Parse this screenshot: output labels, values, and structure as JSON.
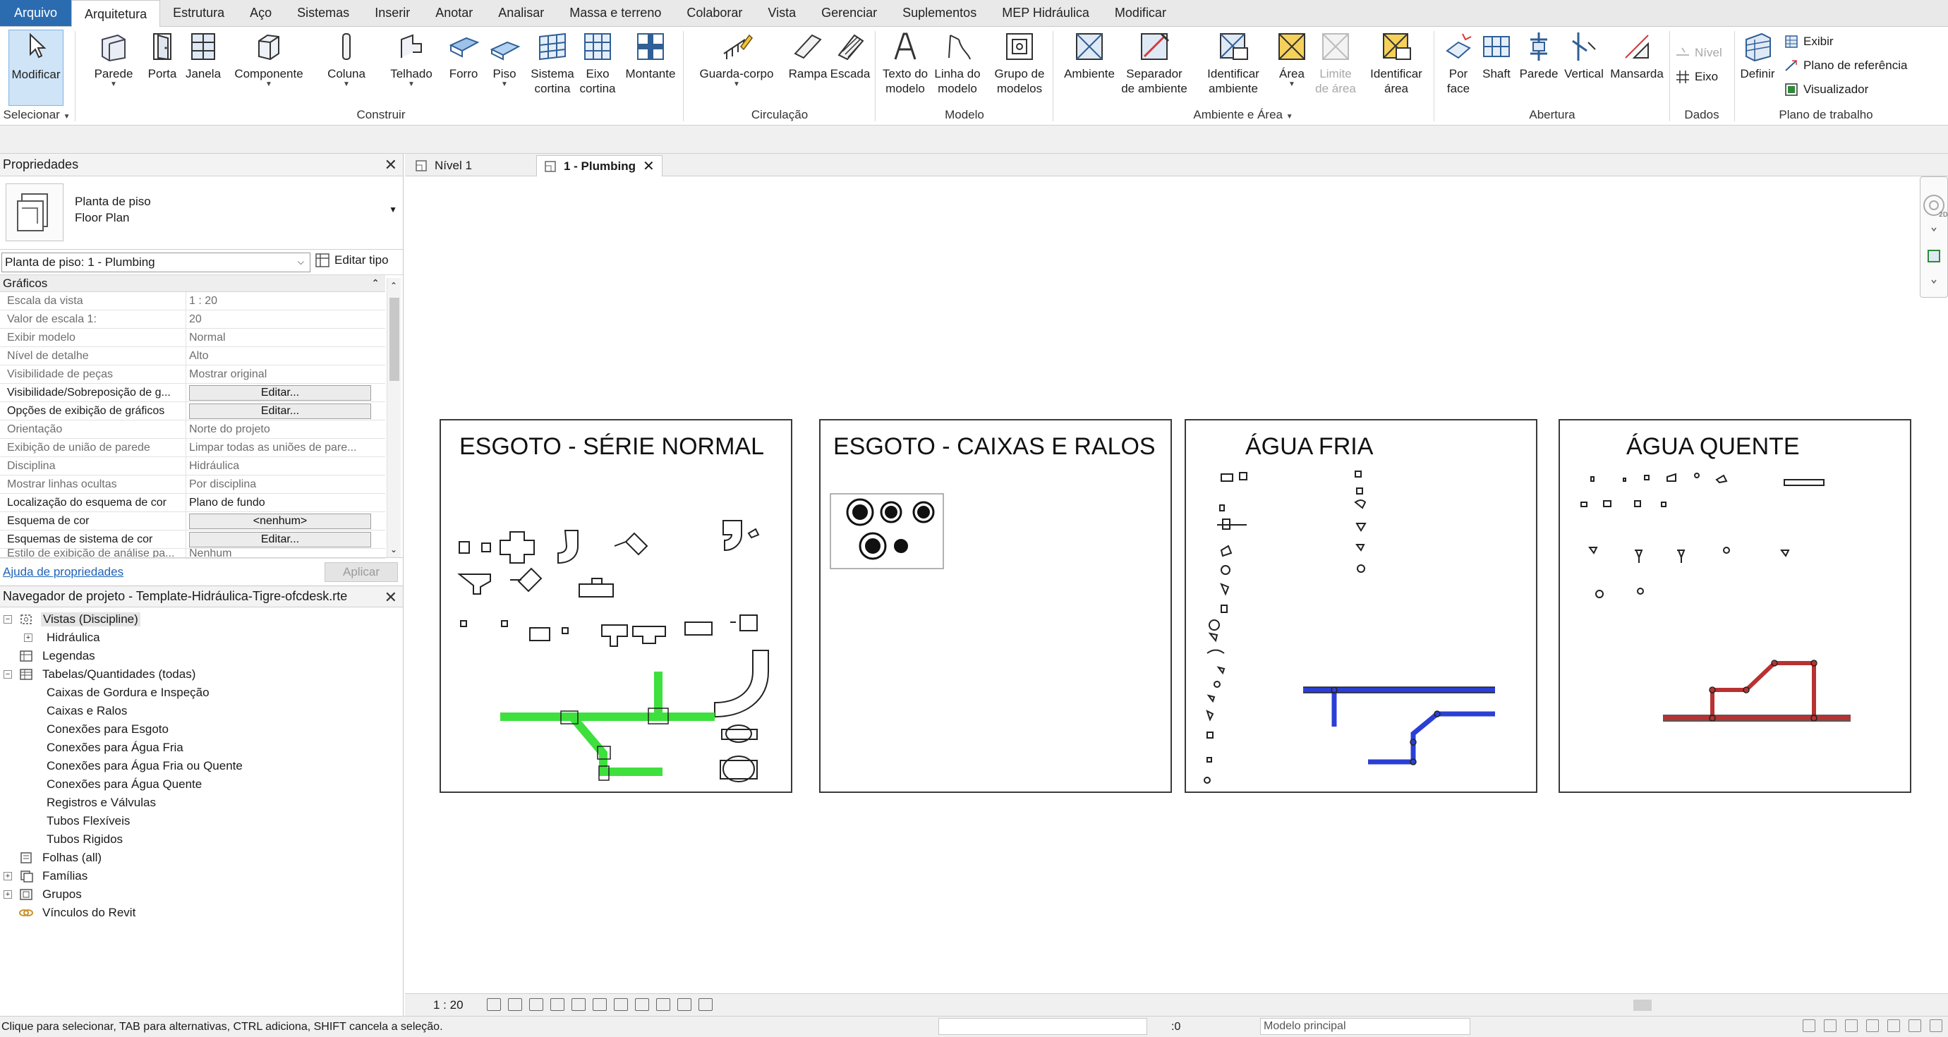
{
  "ribbon": {
    "tabs": [
      "Arquivo",
      "Arquitetura",
      "Estrutura",
      "Aço",
      "Sistemas",
      "Inserir",
      "Anotar",
      "Analisar",
      "Massa e terreno",
      "Colaborar",
      "Vista",
      "Gerenciar",
      "Suplementos",
      "MEP Hidráulica",
      "Modificar"
    ],
    "active_tab": "Arquitetura",
    "buttons": {
      "modificar": "Modificar",
      "parede": "Parede",
      "porta": "Porta",
      "janela": "Janela",
      "componente": "Componente",
      "coluna": "Coluna",
      "telhado": "Telhado",
      "forro": "Forro",
      "piso": "Piso",
      "sistema_cortina_1": "Sistema",
      "sistema_cortina_2": "cortina",
      "eixo_cortina_1": "Eixo",
      "eixo_cortina_2": "cortina",
      "montante": "Montante",
      "guarda_corpo": "Guarda-corpo",
      "rampa": "Rampa",
      "escada": "Escada",
      "texto_modelo_1": "Texto do",
      "texto_modelo_2": "modelo",
      "linha_modelo_1": "Linha do",
      "linha_modelo_2": "modelo",
      "grupo_modelos_1": "Grupo de",
      "grupo_modelos_2": "modelos",
      "ambiente": "Ambiente",
      "separador_1": "Separador",
      "separador_2": "de ambiente",
      "identificar_amb_1": "Identificar",
      "identificar_amb_2": "ambiente",
      "area": "Área",
      "limite_area_1": "Limite",
      "limite_area_2": "de área",
      "identificar_area_1": "Identificar",
      "identificar_area_2": "área",
      "por_face_1": "Por",
      "por_face_2": "face",
      "shaft": "Shaft",
      "parede_abertura": "Parede",
      "vertical": "Vertical",
      "mansarda": "Mansarda",
      "nivel": "Nível",
      "eixo": "Eixo",
      "definir": "Definir",
      "exibir": "Exibir",
      "plano_referencia": "Plano de  referência",
      "visualizador": "Visualizador"
    },
    "panels": {
      "selecionar": "Selecionar",
      "construir": "Construir",
      "circulacao": "Circulação",
      "modelo": "Modelo",
      "ambiente_area": "Ambiente e Área",
      "abertura": "Abertura",
      "dados": "Dados",
      "plano_trabalho": "Plano de trabalho"
    }
  },
  "properties": {
    "title": "Propriedades",
    "type_name_1": "Planta de piso",
    "type_name_2": "Floor Plan",
    "instance": "Planta de piso: 1 - Plumbing",
    "edit_type": "Editar tipo",
    "group": "Gráficos",
    "rows": [
      {
        "k": "Escala da vista",
        "v": "1 : 20"
      },
      {
        "k": "Valor de escala    1:",
        "v": "20"
      },
      {
        "k": "Exibir modelo",
        "v": "Normal"
      },
      {
        "k": "Nível de detalhe",
        "v": "Alto"
      },
      {
        "k": "Visibilidade de peças",
        "v": "Mostrar original"
      },
      {
        "k": "Visibilidade/Sobreposição de g...",
        "v": "Editar..."
      },
      {
        "k": "Opções de exibição de gráficos",
        "v": "Editar..."
      },
      {
        "k": "Orientação",
        "v": "Norte do projeto"
      },
      {
        "k": "Exibição de união de parede",
        "v": "Limpar todas as uniões de pare..."
      },
      {
        "k": "Disciplina",
        "v": "Hidráulica"
      },
      {
        "k": "Mostrar linhas ocultas",
        "v": "Por disciplina"
      },
      {
        "k": "Localização do esquema de cor",
        "v": "Plano de fundo"
      },
      {
        "k": "Esquema de cor",
        "v": "<nenhum>"
      },
      {
        "k": "Esquemas de sistema de cor",
        "v": "Editar..."
      },
      {
        "k": "Estilo de exibição de análise pa...",
        "v": "Nenhum"
      }
    ],
    "help": "Ajuda de propriedades",
    "apply": "Aplicar"
  },
  "browser": {
    "title": "Navegador de projeto - Template-Hidráulica-Tigre-ofcdesk.rte",
    "items": [
      "Vistas (Discipline)",
      "Hidráulica",
      "Legendas",
      "Tabelas/Quantidades (todas)",
      "Caixas de Gordura e Inspeção",
      "Caixas e Ralos",
      "Conexões para Esgoto",
      "Conexões para Água Fria",
      "Conexões para Água Fria ou Quente",
      "Conexões para Água Quente",
      "Registros e Válvulas",
      "Tubos Flexíveis",
      "Tubos Rigidos",
      "Folhas (all)",
      "Famílias",
      "Grupos",
      "Vínculos do Revit"
    ]
  },
  "view_tabs": [
    "Nível 1",
    "1 - Plumbing"
  ],
  "legends": {
    "esgoto_normal": "ESGOTO - SÉRIE NORMAL",
    "esgoto_caixas": "ESGOTO - CAIXAS E RALOS",
    "agua_fria": "ÁGUA FRIA",
    "agua_quente": "ÁGUA QUENTE"
  },
  "viewbar": {
    "scale": "1 : 20"
  },
  "status": {
    "message": "Clique para selecionar, TAB para alternativas, CTRL adiciona, SHIFT cancela a seleção.",
    "zero": ":0",
    "model": "Modelo principal",
    "filter": ":0"
  },
  "colors": {
    "sewer_pipe": "#3ee03e",
    "cold_pipe": "#2b3fd6",
    "hot_pipe": "#b83232",
    "file_tab": "#2b6cb0"
  }
}
